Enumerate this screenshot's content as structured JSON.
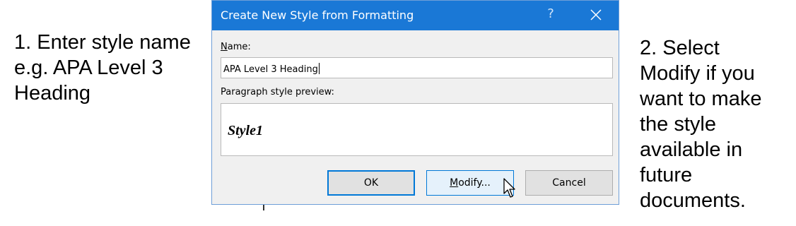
{
  "annotations": {
    "left_lines": [
      "1. Enter style name",
      "e.g. APA Level 3",
      "Heading"
    ],
    "right_lines": [
      "2. Select",
      "Modify if you",
      "want to make",
      "the style",
      "available in",
      "future",
      "documents."
    ]
  },
  "dialog": {
    "title": "Create New Style from Formatting",
    "help_glyph": "?",
    "name_label": "Name:",
    "name_value": "APA Level 3 Heading",
    "preview_label": "Paragraph style preview:",
    "preview_text": "Style1",
    "buttons": {
      "ok": "OK",
      "modify": "Modify...",
      "cancel": "Cancel"
    }
  },
  "colors": {
    "titlebar": "#1a78d6",
    "accent_focus": "#0078d7",
    "dialog_bg": "#f0f0f0"
  },
  "icons": {
    "close": "close-icon",
    "help": "help-icon",
    "cursor": "mouse-pointer-icon"
  }
}
